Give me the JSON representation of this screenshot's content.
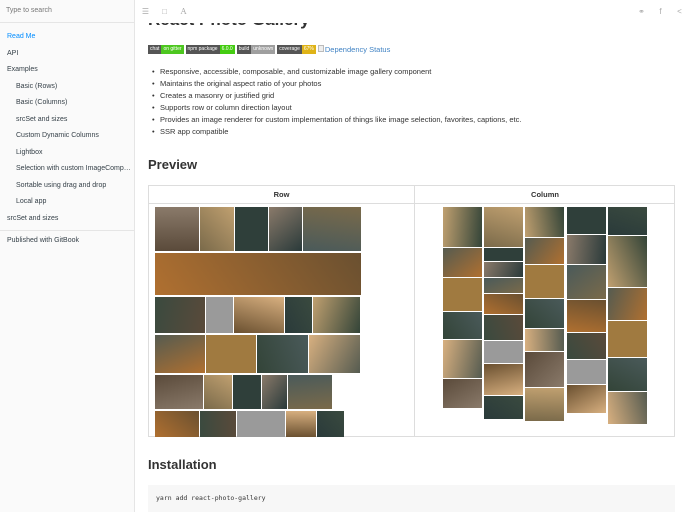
{
  "sidebar": {
    "search_placeholder": "Type to search",
    "items": [
      {
        "label": "Read Me",
        "level": 0,
        "active": true
      },
      {
        "label": "API",
        "level": 0
      },
      {
        "label": "Examples",
        "level": 0
      },
      {
        "label": "Basic (Rows)",
        "level": 1
      },
      {
        "label": "Basic (Columns)",
        "level": 1
      },
      {
        "label": "srcSet and sizes",
        "level": 1
      },
      {
        "label": "Custom Dynamic Columns",
        "level": 1
      },
      {
        "label": "Lightbox",
        "level": 1
      },
      {
        "label": "Selection with custom ImageComponent",
        "level": 1
      },
      {
        "label": "Sortable using drag and drop",
        "level": 1
      },
      {
        "label": "Local app",
        "level": 1
      },
      {
        "label": "srcSet and sizes",
        "level": 0
      }
    ],
    "published": "Published with GitBook"
  },
  "header": {
    "icons": [
      "menu-icon",
      "book-icon",
      "font-icon",
      "twitter-icon",
      "facebook-icon",
      "share-icon"
    ]
  },
  "main": {
    "title": "React Photo Gallery",
    "badges": [
      {
        "left": "chat",
        "right": "on gitter",
        "color": "#4dc71f"
      },
      {
        "left": "npm package",
        "right": "6.0.0",
        "color": "#4c1"
      },
      {
        "left": "build",
        "right": "unknown",
        "color": "#9f9f9f"
      },
      {
        "left": "coverage",
        "right": "67%",
        "color": "#dfb317"
      }
    ],
    "dep_status": "Dependency Status",
    "features": [
      "Responsive, accessible, composable, and customizable image gallery component",
      "Maintains the original aspect ratio of your photos",
      "Creates a masonry or justified grid",
      "Supports row or column direction layout",
      "Provides an image renderer for custom implementation of things like image selection, favorites, captions, etc.",
      "SSR app compatible"
    ],
    "preview_heading": "Preview",
    "preview_table": {
      "col_row": "Row",
      "col_column": "Column"
    },
    "installation_heading": "Installation",
    "install_code": "yarn add react-photo-gallery"
  }
}
